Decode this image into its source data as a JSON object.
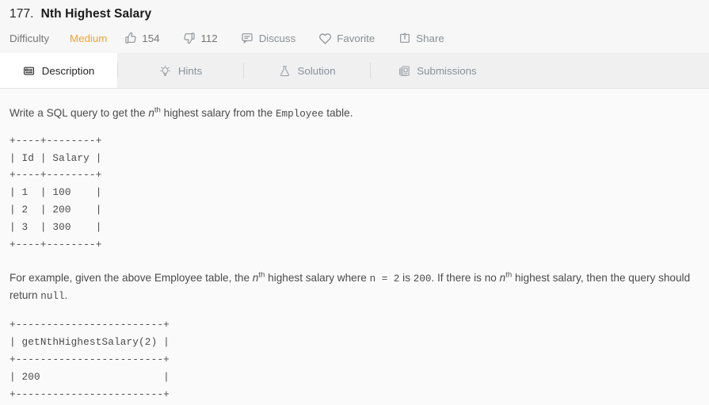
{
  "problem": {
    "number": "177.",
    "title": "Nth Highest Salary"
  },
  "meta": {
    "difficulty_label": "Difficulty",
    "difficulty_value": "Medium",
    "difficulty_color": "#efa32d",
    "likes": "154",
    "dislikes": "112",
    "discuss_label": "Discuss",
    "favorite_label": "Favorite",
    "share_label": "Share",
    "icons": {
      "likes": "thumbs-up-icon",
      "dislikes": "thumbs-down-icon",
      "discuss": "comment-icon",
      "favorite": "heart-icon",
      "share": "share-icon"
    }
  },
  "tabs": [
    {
      "label": "Description",
      "icon": "description-icon",
      "active": true
    },
    {
      "label": "Hints",
      "icon": "lightbulb-icon",
      "active": false
    },
    {
      "label": "Solution",
      "icon": "flask-icon",
      "active": false
    },
    {
      "label": "Submissions",
      "icon": "documents-icon",
      "active": false
    }
  ],
  "description": {
    "p1_before": "Write a SQL query to get the ",
    "p1_n": "n",
    "p1_sup": "th",
    "p1_mid": " highest salary from the ",
    "p1_code": "Employee",
    "p1_after": " table.",
    "table1": "+----+--------+\n| Id | Salary |\n+----+--------+\n| 1  | 100    |\n| 2  | 200    |\n| 3  | 300    |\n+----+--------+",
    "p2_a": "For example, given the above Employee table, the ",
    "p2_n1": "n",
    "p2_sup1": "th",
    "p2_b": " highest salary where ",
    "p2_code1": "n = 2",
    "p2_c": " is ",
    "p2_code2": "200",
    "p2_d": ". If there is no ",
    "p2_n2": "n",
    "p2_sup2": "th",
    "p2_e": " highest salary, then the query should return ",
    "p2_code3": "null",
    "p2_f": ".",
    "table2": "+------------------------+\n| getNthHighestSalary(2) |\n+------------------------+\n| 200                    |\n+------------------------+"
  }
}
